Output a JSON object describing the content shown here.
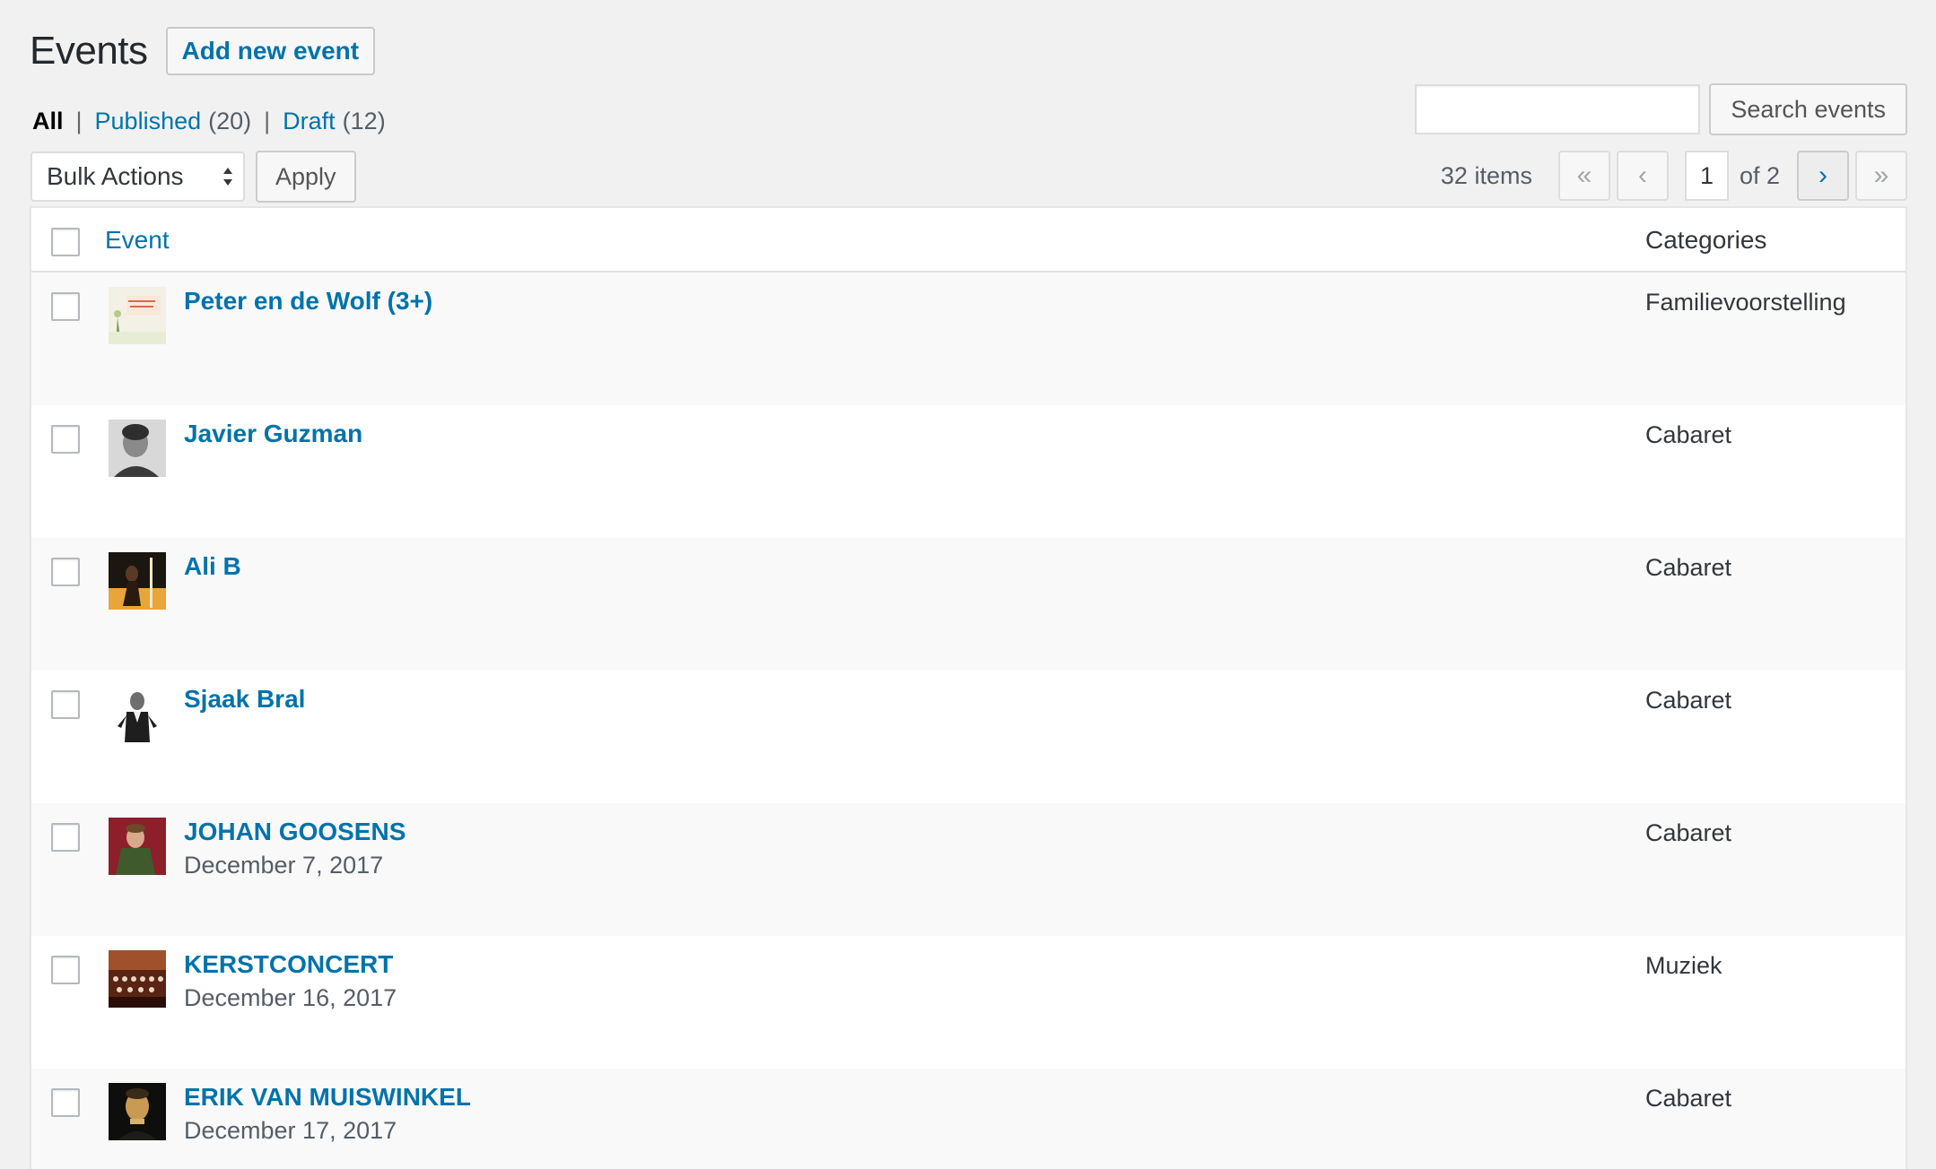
{
  "header": {
    "title": "Events",
    "add_new_label": "Add new event"
  },
  "views": {
    "all_label": "All",
    "published_label": "Published",
    "published_count": "(20)",
    "draft_label": "Draft",
    "draft_count": "(12)",
    "separator": "|"
  },
  "search": {
    "button_label": "Search events",
    "value": ""
  },
  "bulk": {
    "selected": "Bulk Actions",
    "apply_label": "Apply"
  },
  "pagination": {
    "items": "32 items",
    "first": "«",
    "prev": "‹",
    "current_page": "1",
    "of_total": "of 2",
    "next": "›",
    "last": "»"
  },
  "table": {
    "columns": {
      "event": "Event",
      "categories": "Categories"
    },
    "rows": [
      {
        "title": "Peter en de Wolf (3+)",
        "date": "",
        "category": "Familievoorstelling",
        "thumb": "illustration-thumbnail"
      },
      {
        "title": "Javier Guzman",
        "date": "",
        "category": "Cabaret",
        "thumb": "portrait-thumbnail"
      },
      {
        "title": "Ali B",
        "date": "",
        "category": "Cabaret",
        "thumb": "performer-thumbnail"
      },
      {
        "title": "Sjaak Bral",
        "date": "",
        "category": "Cabaret",
        "thumb": "portrait-thumbnail"
      },
      {
        "title": "JOHAN GOOSENS",
        "date": "December 7, 2017",
        "category": "Cabaret",
        "thumb": "portrait-thumbnail"
      },
      {
        "title": "KERSTCONCERT",
        "date": "December 16, 2017",
        "category": "Muziek",
        "thumb": "choir-thumbnail"
      },
      {
        "title": "ERIK VAN MUISWINKEL",
        "date": "December 17, 2017",
        "category": "Cabaret",
        "thumb": "portrait-thumbnail"
      }
    ]
  },
  "colors": {
    "link": "#0073aa",
    "background": "#f1f1f1",
    "row_alt": "#f9f9f9"
  }
}
